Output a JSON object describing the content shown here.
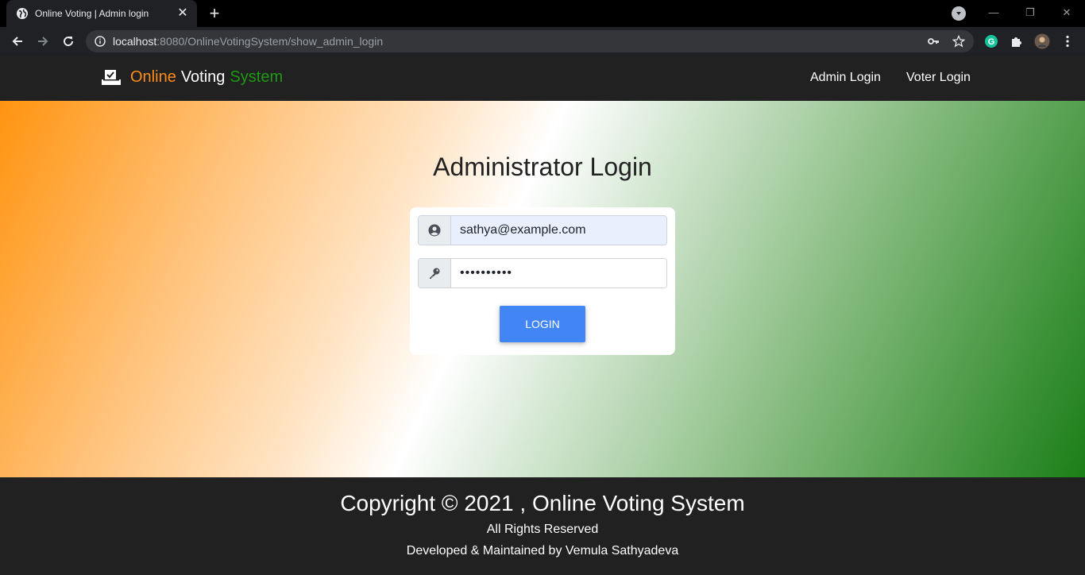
{
  "browser": {
    "tab_title": "Online Voting | Admin login",
    "new_tab_symbol": "+",
    "tab_close_symbol": "✕",
    "url_host": "localhost",
    "url_rest": ":8080/OnlineVotingSystem/show_admin_login",
    "window_controls": [
      "—",
      "❐",
      "✕"
    ],
    "profile_icon": "profile-avatar-icon"
  },
  "header": {
    "brand_words": [
      "Online",
      "Voting",
      "System"
    ],
    "brand_colors": [
      "#ff8c1a",
      "#ffffff",
      "#1e9a14"
    ],
    "nav": [
      "Admin Login",
      "Voter Login"
    ]
  },
  "login": {
    "title": "Administrator Login",
    "email_value": "sathya@example.com",
    "password_value": "••••••••••",
    "button_label": "LOGIN"
  },
  "footer": {
    "copyright": "Copyright © 2021 , Online Voting System",
    "rights": "All Rights Reserved",
    "developed_by": "Developed & Maintained by Vemula Sathyadeva"
  },
  "colors": {
    "gradient": [
      "#ff9410",
      "#ffffff",
      "#1b7f17"
    ],
    "button": "#4285f4",
    "header_bg": "#212121"
  }
}
